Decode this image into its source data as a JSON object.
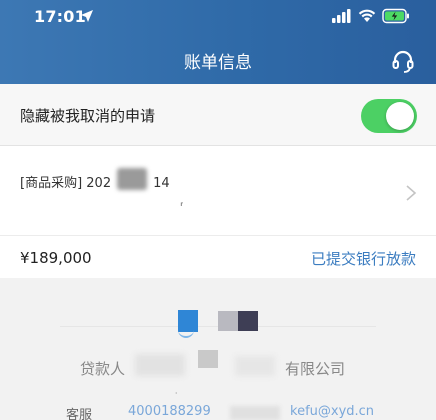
{
  "status_bar": {
    "time": "17:01",
    "icons": [
      "location-arrow-icon",
      "signal-icon",
      "wifi-icon",
      "battery-charging-icon"
    ]
  },
  "header": {
    "title": "账单信息",
    "action_icon": "headset-icon"
  },
  "filter": {
    "label": "隐藏被我取消的申请",
    "enabled": true
  },
  "bill": {
    "name": "[商品采购] 202",
    "name_suffix": "14",
    "amount": "¥189,000",
    "status": "已提交银行放款"
  },
  "footer": {
    "lender_label": "贷款人",
    "lender_name": "有限公司",
    "service_label": "客服",
    "service_phone": "4000188299",
    "service_email": "kefu@xyd.cn"
  },
  "colors": {
    "header": "#2f6aa8",
    "toggle_on": "#4cd064",
    "link": "#3b7cc0"
  }
}
